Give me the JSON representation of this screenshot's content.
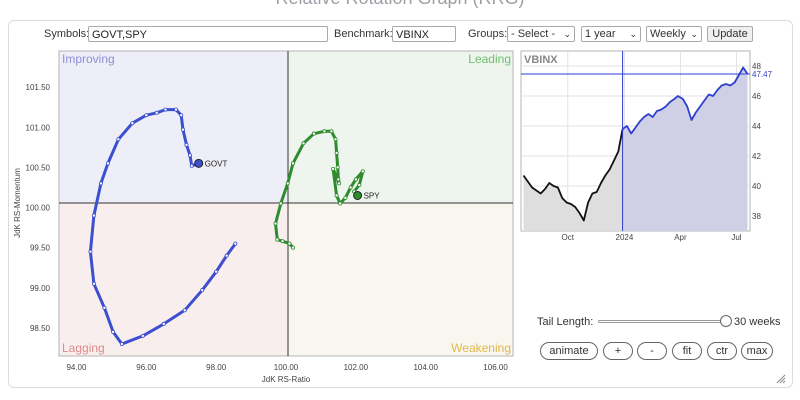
{
  "page_title": "Relative Rotation Graph (RRG)",
  "toolbar": {
    "symbols_label": "Symbols:",
    "symbols_value": "GOVT,SPY",
    "benchmark_label": "Benchmark:",
    "benchmark_value": "VBINX",
    "groups_label": "Groups:",
    "groups_value": "- Select -",
    "period_value": "1 year",
    "frequency_value": "Weekly",
    "update_label": "Update"
  },
  "rrg": {
    "quadrants": {
      "improving": "Improving",
      "leading": "Leading",
      "lagging": "Lagging",
      "weakening": "Weakening"
    },
    "x_axis_title": "JdK RS-Ratio",
    "y_axis_title": "JdK RS-Momentum",
    "x_ticks": [
      "94.00",
      "96.00",
      "98.00",
      "100.00",
      "102.00",
      "104.00",
      "106.00"
    ],
    "y_ticks": [
      "101.50",
      "101.00",
      "100.50",
      "100.00",
      "99.50",
      "99.00",
      "98.50"
    ],
    "colors": {
      "improving_bg": "#eeeef8",
      "leading_bg": "#eef5ee",
      "lagging_bg": "#f8eeee",
      "weakening_bg": "#f8f6ee",
      "improving_text": "#8a8fd6",
      "leading_text": "#6fbf6f",
      "lagging_text": "#e08a8a",
      "weakening_text": "#e0b84a"
    }
  },
  "chart_data": [
    {
      "type": "scatter",
      "title": "",
      "xlabel": "JdK RS-Ratio",
      "ylabel": "JdK RS-Momentum",
      "xlim": [
        93.5,
        106.5
      ],
      "ylim": [
        98.15,
        101.95
      ],
      "series": [
        {
          "name": "GOVT",
          "color": "#3c4fcf",
          "points": [
            [
              98.55,
              99.55
            ],
            [
              98.3,
              99.4
            ],
            [
              98.0,
              99.2
            ],
            [
              97.6,
              98.97
            ],
            [
              97.1,
              98.72
            ],
            [
              96.5,
              98.55
            ],
            [
              95.9,
              98.4
            ],
            [
              95.3,
              98.3
            ],
            [
              95.05,
              98.45
            ],
            [
              94.8,
              98.75
            ],
            [
              94.5,
              99.05
            ],
            [
              94.4,
              99.45
            ],
            [
              94.5,
              99.9
            ],
            [
              94.7,
              100.3
            ],
            [
              94.9,
              100.55
            ],
            [
              95.2,
              100.85
            ],
            [
              95.6,
              101.05
            ],
            [
              96.0,
              101.15
            ],
            [
              96.3,
              101.18
            ],
            [
              96.55,
              101.22
            ],
            [
              96.85,
              101.22
            ],
            [
              97.0,
              101.15
            ],
            [
              97.05,
              100.97
            ],
            [
              97.15,
              100.78
            ],
            [
              97.25,
              100.65
            ],
            [
              97.3,
              100.52
            ],
            [
              97.5,
              100.55
            ]
          ]
        },
        {
          "name": "SPY",
          "color": "#2e8b2e",
          "points": [
            [
              100.2,
              99.5
            ],
            [
              100.1,
              99.55
            ],
            [
              99.9,
              99.58
            ],
            [
              99.75,
              99.6
            ],
            [
              99.7,
              99.8
            ],
            [
              99.85,
              100.05
            ],
            [
              100.05,
              100.3
            ],
            [
              100.2,
              100.55
            ],
            [
              100.5,
              100.8
            ],
            [
              100.8,
              100.92
            ],
            [
              101.1,
              100.95
            ],
            [
              101.3,
              100.95
            ],
            [
              101.42,
              100.85
            ],
            [
              101.45,
              100.68
            ],
            [
              101.48,
              100.5
            ],
            [
              101.5,
              100.35
            ],
            [
              101.52,
              100.3
            ],
            [
              101.35,
              100.48
            ],
            [
              101.45,
              100.15
            ],
            [
              101.55,
              100.05
            ],
            [
              101.7,
              100.12
            ],
            [
              101.85,
              100.25
            ],
            [
              102.0,
              100.35
            ],
            [
              102.2,
              100.45
            ],
            [
              102.1,
              100.28
            ],
            [
              101.95,
              100.2
            ],
            [
              102.05,
              100.15
            ]
          ]
        }
      ]
    },
    {
      "type": "area",
      "title": "VBINX",
      "x_tick_labels": [
        "Oct",
        "2024",
        "Apr",
        "Jul"
      ],
      "y_ticks": [
        38,
        40,
        42,
        44,
        46,
        48
      ],
      "ylim": [
        37,
        49
      ],
      "last_value_label": "47.47",
      "x": [
        "2023-07-21",
        "2023-07-28",
        "2023-08-04",
        "2023-08-11",
        "2023-08-18",
        "2023-08-25",
        "2023-09-01",
        "2023-09-08",
        "2023-09-15",
        "2023-09-22",
        "2023-09-29",
        "2023-10-06",
        "2023-10-13",
        "2023-10-20",
        "2023-10-27",
        "2023-11-03",
        "2023-11-10",
        "2023-11-17",
        "2023-11-24",
        "2023-12-01",
        "2023-12-08",
        "2023-12-15",
        "2023-12-22",
        "2023-12-29",
        "2024-01-05",
        "2024-01-12",
        "2024-01-19",
        "2024-01-26",
        "2024-02-02",
        "2024-02-09",
        "2024-02-16",
        "2024-02-23",
        "2024-03-01",
        "2024-03-08",
        "2024-03-15",
        "2024-03-22",
        "2024-03-28",
        "2024-04-05",
        "2024-04-12",
        "2024-04-19",
        "2024-04-26",
        "2024-05-03",
        "2024-05-10",
        "2024-05-17",
        "2024-05-24",
        "2024-05-31",
        "2024-06-07",
        "2024-06-14",
        "2024-06-21",
        "2024-06-28",
        "2024-07-05",
        "2024-07-12",
        "2024-07-19"
      ],
      "values": [
        40.7,
        40.3,
        39.9,
        39.7,
        39.5,
        39.8,
        40.2,
        40.0,
        39.9,
        39.2,
        38.9,
        38.8,
        38.6,
        38.2,
        37.7,
        38.9,
        39.5,
        39.6,
        40.2,
        40.7,
        41.1,
        41.7,
        42.3,
        43.8,
        44.0,
        43.5,
        43.9,
        44.3,
        44.6,
        44.8,
        44.6,
        45.0,
        45.1,
        45.3,
        45.6,
        45.8,
        46.0,
        45.8,
        45.3,
        44.4,
        44.9,
        45.3,
        45.7,
        46.1,
        46.0,
        46.4,
        46.7,
        46.8,
        46.7,
        46.9,
        47.4,
        47.9,
        47.47
      ]
    }
  ],
  "bottom_controls": {
    "tail_length_label": "Tail Length:",
    "tail_length_value": "30 weeks",
    "tail_length_fraction": 1.0,
    "buttons": {
      "animate": "animate",
      "plus": "+",
      "minus": "-",
      "fit": "fit",
      "ctr": "ctr",
      "max": "max"
    }
  }
}
